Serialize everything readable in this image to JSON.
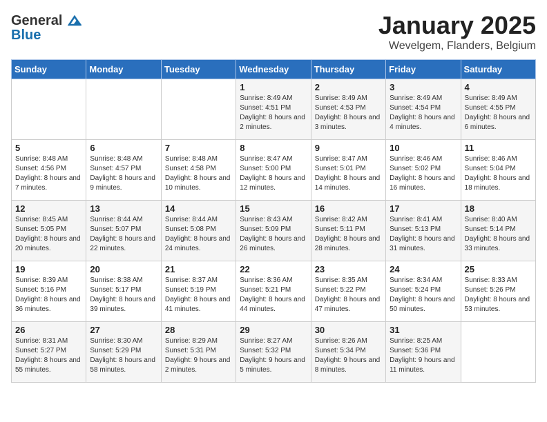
{
  "logo": {
    "general": "General",
    "blue": "Blue"
  },
  "header": {
    "month": "January 2025",
    "location": "Wevelgem, Flanders, Belgium"
  },
  "weekdays": [
    "Sunday",
    "Monday",
    "Tuesday",
    "Wednesday",
    "Thursday",
    "Friday",
    "Saturday"
  ],
  "weeks": [
    [
      {
        "day": "",
        "info": ""
      },
      {
        "day": "",
        "info": ""
      },
      {
        "day": "",
        "info": ""
      },
      {
        "day": "1",
        "info": "Sunrise: 8:49 AM\nSunset: 4:51 PM\nDaylight: 8 hours and 2 minutes."
      },
      {
        "day": "2",
        "info": "Sunrise: 8:49 AM\nSunset: 4:53 PM\nDaylight: 8 hours and 3 minutes."
      },
      {
        "day": "3",
        "info": "Sunrise: 8:49 AM\nSunset: 4:54 PM\nDaylight: 8 hours and 4 minutes."
      },
      {
        "day": "4",
        "info": "Sunrise: 8:49 AM\nSunset: 4:55 PM\nDaylight: 8 hours and 6 minutes."
      }
    ],
    [
      {
        "day": "5",
        "info": "Sunrise: 8:48 AM\nSunset: 4:56 PM\nDaylight: 8 hours and 7 minutes."
      },
      {
        "day": "6",
        "info": "Sunrise: 8:48 AM\nSunset: 4:57 PM\nDaylight: 8 hours and 9 minutes."
      },
      {
        "day": "7",
        "info": "Sunrise: 8:48 AM\nSunset: 4:58 PM\nDaylight: 8 hours and 10 minutes."
      },
      {
        "day": "8",
        "info": "Sunrise: 8:47 AM\nSunset: 5:00 PM\nDaylight: 8 hours and 12 minutes."
      },
      {
        "day": "9",
        "info": "Sunrise: 8:47 AM\nSunset: 5:01 PM\nDaylight: 8 hours and 14 minutes."
      },
      {
        "day": "10",
        "info": "Sunrise: 8:46 AM\nSunset: 5:02 PM\nDaylight: 8 hours and 16 minutes."
      },
      {
        "day": "11",
        "info": "Sunrise: 8:46 AM\nSunset: 5:04 PM\nDaylight: 8 hours and 18 minutes."
      }
    ],
    [
      {
        "day": "12",
        "info": "Sunrise: 8:45 AM\nSunset: 5:05 PM\nDaylight: 8 hours and 20 minutes."
      },
      {
        "day": "13",
        "info": "Sunrise: 8:44 AM\nSunset: 5:07 PM\nDaylight: 8 hours and 22 minutes."
      },
      {
        "day": "14",
        "info": "Sunrise: 8:44 AM\nSunset: 5:08 PM\nDaylight: 8 hours and 24 minutes."
      },
      {
        "day": "15",
        "info": "Sunrise: 8:43 AM\nSunset: 5:09 PM\nDaylight: 8 hours and 26 minutes."
      },
      {
        "day": "16",
        "info": "Sunrise: 8:42 AM\nSunset: 5:11 PM\nDaylight: 8 hours and 28 minutes."
      },
      {
        "day": "17",
        "info": "Sunrise: 8:41 AM\nSunset: 5:13 PM\nDaylight: 8 hours and 31 minutes."
      },
      {
        "day": "18",
        "info": "Sunrise: 8:40 AM\nSunset: 5:14 PM\nDaylight: 8 hours and 33 minutes."
      }
    ],
    [
      {
        "day": "19",
        "info": "Sunrise: 8:39 AM\nSunset: 5:16 PM\nDaylight: 8 hours and 36 minutes."
      },
      {
        "day": "20",
        "info": "Sunrise: 8:38 AM\nSunset: 5:17 PM\nDaylight: 8 hours and 39 minutes."
      },
      {
        "day": "21",
        "info": "Sunrise: 8:37 AM\nSunset: 5:19 PM\nDaylight: 8 hours and 41 minutes."
      },
      {
        "day": "22",
        "info": "Sunrise: 8:36 AM\nSunset: 5:21 PM\nDaylight: 8 hours and 44 minutes."
      },
      {
        "day": "23",
        "info": "Sunrise: 8:35 AM\nSunset: 5:22 PM\nDaylight: 8 hours and 47 minutes."
      },
      {
        "day": "24",
        "info": "Sunrise: 8:34 AM\nSunset: 5:24 PM\nDaylight: 8 hours and 50 minutes."
      },
      {
        "day": "25",
        "info": "Sunrise: 8:33 AM\nSunset: 5:26 PM\nDaylight: 8 hours and 53 minutes."
      }
    ],
    [
      {
        "day": "26",
        "info": "Sunrise: 8:31 AM\nSunset: 5:27 PM\nDaylight: 8 hours and 55 minutes."
      },
      {
        "day": "27",
        "info": "Sunrise: 8:30 AM\nSunset: 5:29 PM\nDaylight: 8 hours and 58 minutes."
      },
      {
        "day": "28",
        "info": "Sunrise: 8:29 AM\nSunset: 5:31 PM\nDaylight: 9 hours and 2 minutes."
      },
      {
        "day": "29",
        "info": "Sunrise: 8:27 AM\nSunset: 5:32 PM\nDaylight: 9 hours and 5 minutes."
      },
      {
        "day": "30",
        "info": "Sunrise: 8:26 AM\nSunset: 5:34 PM\nDaylight: 9 hours and 8 minutes."
      },
      {
        "day": "31",
        "info": "Sunrise: 8:25 AM\nSunset: 5:36 PM\nDaylight: 9 hours and 11 minutes."
      },
      {
        "day": "",
        "info": ""
      }
    ]
  ]
}
